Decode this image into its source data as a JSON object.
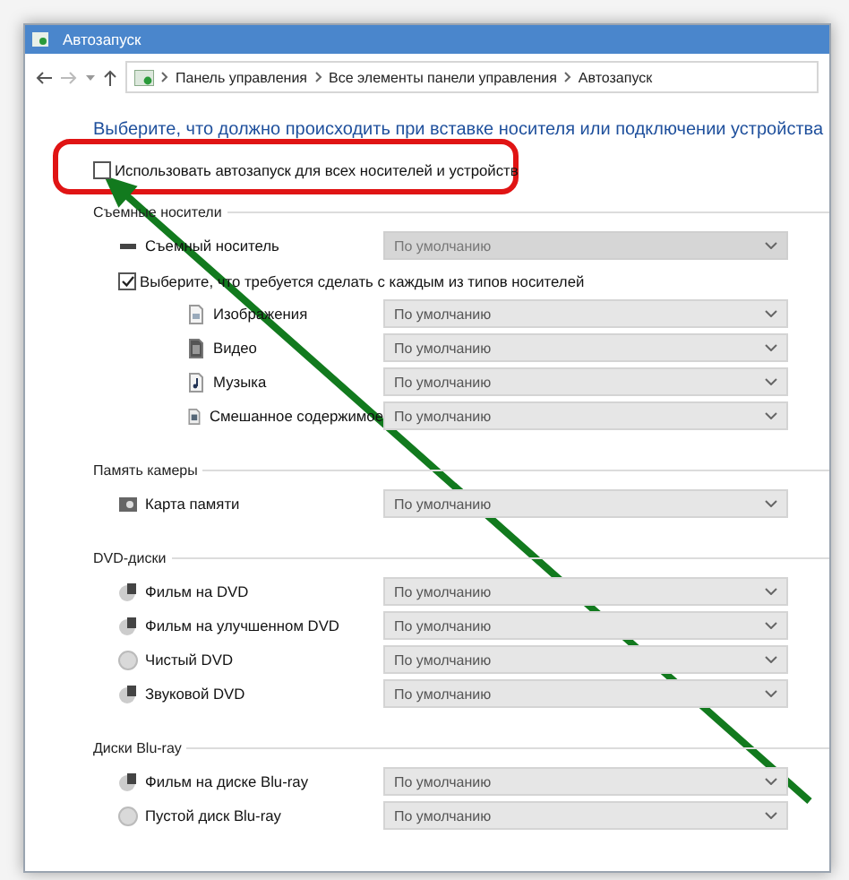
{
  "window": {
    "title": "Автозапуск"
  },
  "address_bar": {
    "crumbs": [
      "Панель управления",
      "Все элементы панели управления",
      "Автозапуск"
    ]
  },
  "heading": "Выберите, что должно происходить при вставке носителя или подключении устройства",
  "autoplay_all": {
    "label": "Использовать автозапуск для всех носителей и устройств",
    "checked": false
  },
  "sections": [
    {
      "title": "Съемные носители",
      "items": [
        {
          "kind": "drive",
          "label": "Съемный носитель",
          "value": "По умолчанию",
          "disabled": true
        },
        {
          "kind": "checkbox",
          "label": "Выберите, что требуется сделать с каждым из типов носителей",
          "checked": true,
          "children": [
            {
              "kind": "image",
              "label": "Изображения",
              "value": "По умолчанию",
              "disabled": false
            },
            {
              "kind": "video",
              "label": "Видео",
              "value": "По умолчанию",
              "disabled": false
            },
            {
              "kind": "music",
              "label": "Музыка",
              "value": "По умолчанию",
              "disabled": false
            },
            {
              "kind": "mixed",
              "label": "Смешанное содержимое",
              "value": "По умолчанию",
              "disabled": false
            }
          ]
        }
      ]
    },
    {
      "title": "Память камеры",
      "items": [
        {
          "kind": "card",
          "label": "Карта памяти",
          "value": "По умолчанию",
          "disabled": false
        }
      ]
    },
    {
      "title": "DVD-диски",
      "items": [
        {
          "kind": "movie_disc",
          "label": "Фильм на DVD",
          "value": "По умолчанию",
          "disabled": false
        },
        {
          "kind": "movie_disc",
          "label": "Фильм на улучшенном DVD",
          "value": "По умолчанию",
          "disabled": false
        },
        {
          "kind": "blank_disc",
          "label": "Чистый DVD",
          "value": "По умолчанию",
          "disabled": false
        },
        {
          "kind": "movie_disc",
          "label": "Звуковой DVD",
          "value": "По умолчанию",
          "disabled": false
        }
      ]
    },
    {
      "title": "Диски Blu-ray",
      "items": [
        {
          "kind": "movie_disc",
          "label": "Фильм на диске Blu-ray",
          "value": "По умолчанию",
          "disabled": false
        },
        {
          "kind": "blank_disc",
          "label": "Пустой диск Blu-ray",
          "value": "По умолчанию",
          "disabled": false
        }
      ]
    }
  ]
}
